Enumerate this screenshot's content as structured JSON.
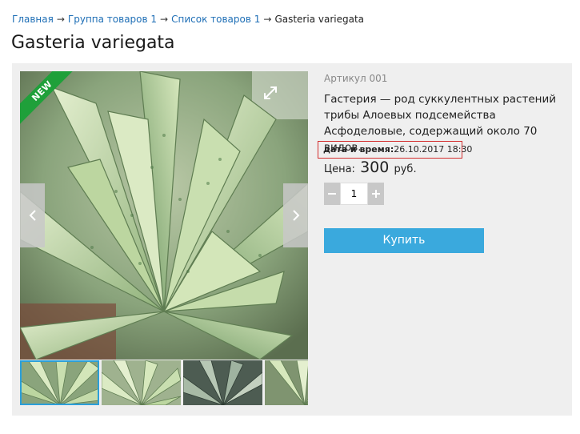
{
  "breadcrumb": {
    "items": [
      {
        "label": "Главная"
      },
      {
        "label": "Группа товаров 1"
      },
      {
        "label": "Список товаров 1"
      }
    ],
    "separator": "→",
    "current": "Gasteria variegata"
  },
  "product": {
    "title": "Gasteria variegata",
    "badge": "NEW",
    "sku": "Артикул 001",
    "description": "Гастерия — род суккулентных растений трибы Алоевых подсемейства Асфоделовые, содержащий около 70 видов.",
    "datetime_label": "дата и время:",
    "datetime_value": "26.10.2017 18:30",
    "price_label": "Цена:",
    "price_value": "300",
    "price_currency": "руб.",
    "quantity": "1",
    "buy_label": "Купить"
  },
  "icons": {
    "prev": "chevron-left-icon",
    "next": "chevron-right-icon",
    "expand": "expand-icon",
    "minus": "minus-icon",
    "plus": "plus-icon"
  },
  "gallery": {
    "thumbnail_count": 4,
    "active_thumbnail": 1
  }
}
